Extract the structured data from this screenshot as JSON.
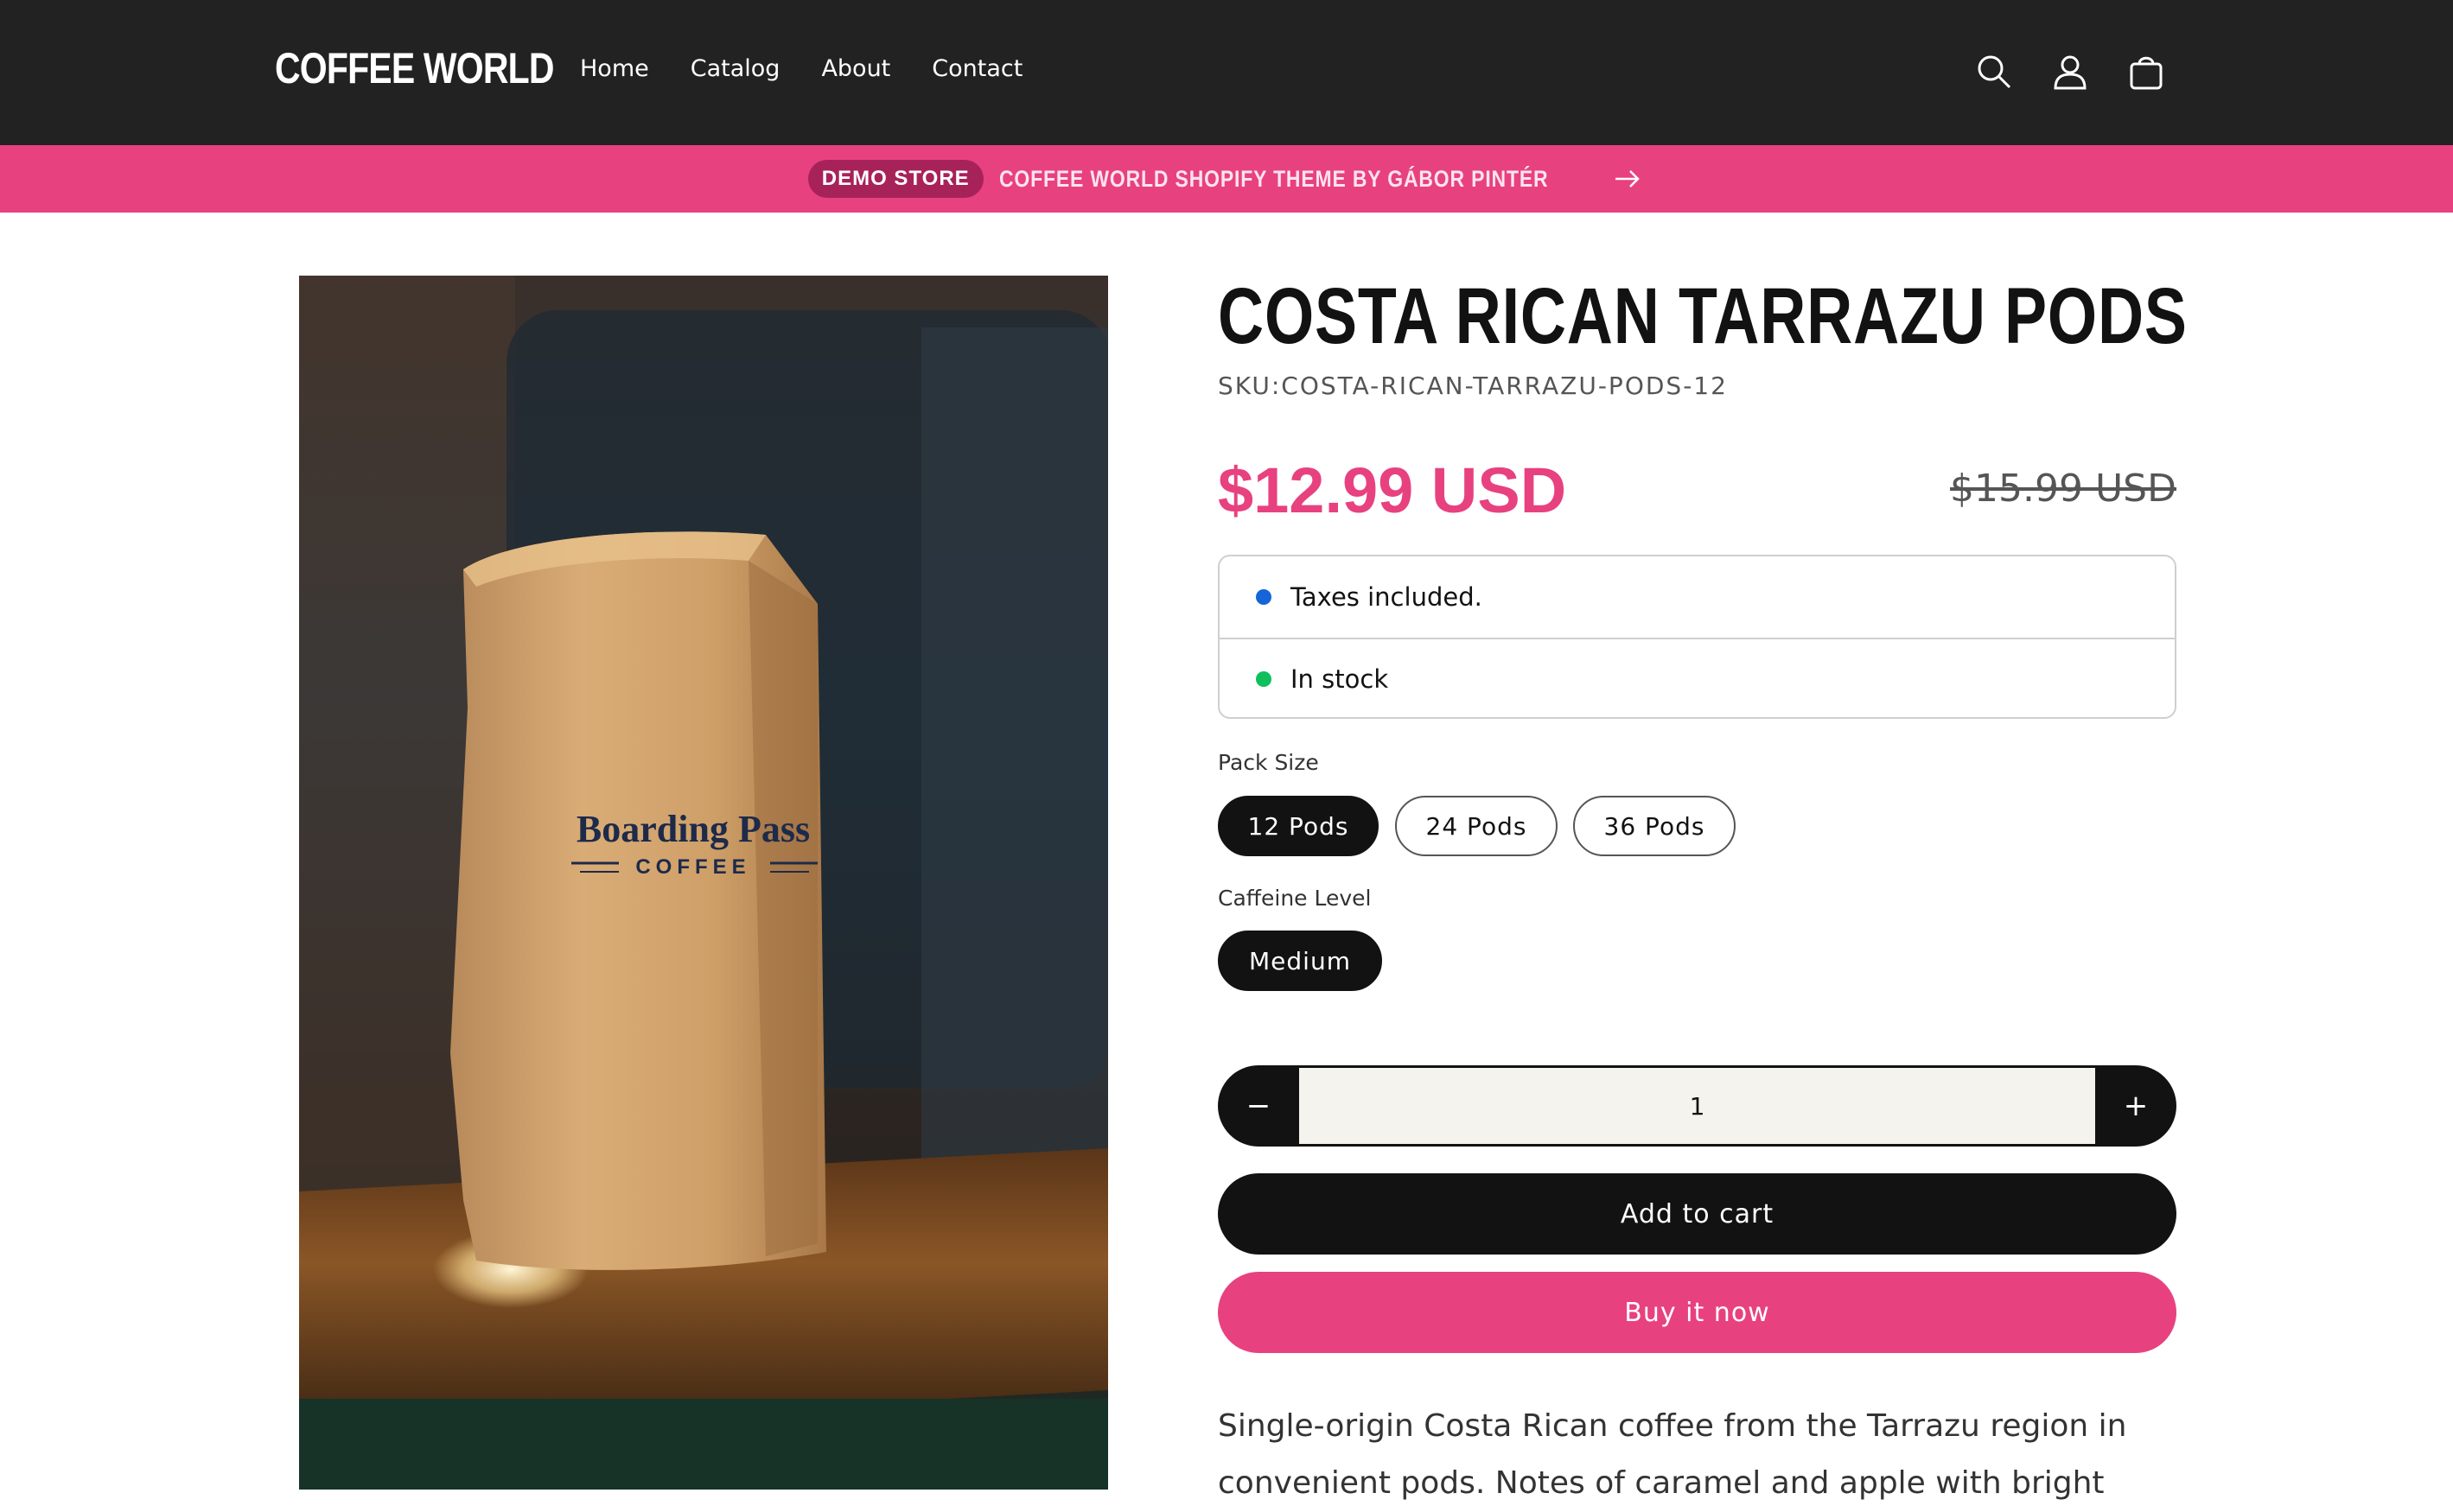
{
  "header": {
    "logo": "COFFEE WORLD",
    "nav": [
      "Home",
      "Catalog",
      "About",
      "Contact"
    ],
    "icons": [
      "search-icon",
      "account-icon",
      "cart-icon"
    ]
  },
  "announcement": {
    "badge": "DEMO STORE",
    "text": "COFFEE WORLD SHOPIFY THEME BY GÁBOR PINTÉR",
    "icon": "arrow-right-icon"
  },
  "product": {
    "image_text": {
      "brand": "Boarding Pass",
      "sub": "COFFEE"
    },
    "title": "COSTA RICAN TARRAZU PODS",
    "sku": "SKU:COSTA-RICAN-TARRAZU-PODS-12",
    "price": "$12.99 USD",
    "compare_price": "$15.99 USD",
    "info": [
      {
        "text": "Taxes included.",
        "color": "#1565d8"
      },
      {
        "text": "In stock",
        "color": "#0fbf5c"
      }
    ],
    "pack_size": {
      "label": "Pack Size",
      "options": [
        "12 Pods",
        "24 Pods",
        "36 Pods"
      ],
      "selected": "12 Pods"
    },
    "caffeine": {
      "label": "Caffeine Level",
      "options": [
        "Medium"
      ],
      "selected": "Medium"
    },
    "quantity": {
      "value": "1",
      "minus": "−",
      "plus": "+"
    },
    "add_to_cart": "Add to cart",
    "buy_now": "Buy it now",
    "description": "Single-origin Costa Rican coffee from the Tarrazu region in convenient pods. Notes of caramel and apple with bright acidity."
  },
  "colors": {
    "accent": "#e8417f",
    "header_bg": "#222222",
    "primary": "#121212"
  }
}
